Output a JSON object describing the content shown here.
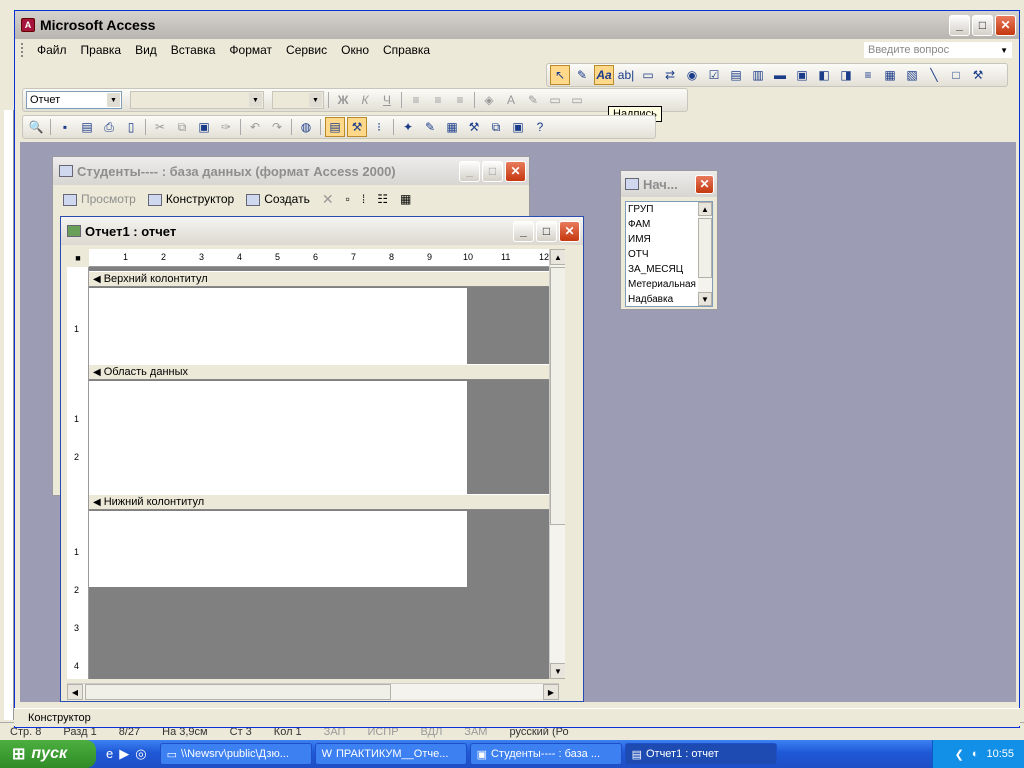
{
  "background": {
    "status_items": [
      "Стр. 8",
      "Разд 1",
      "8/27",
      "На 3,9см",
      "Ст 3",
      "Кол 1",
      "ЗАП",
      "ИСПР",
      "ВДЛ",
      "ЗАМ",
      "русский (Ро"
    ]
  },
  "app": {
    "title": "Microsoft Access",
    "icon_letter": "A",
    "minimize": "_",
    "maximize": "□",
    "close": "✕"
  },
  "menu": {
    "items": [
      "Файл",
      "Правка",
      "Вид",
      "Вставка",
      "Формат",
      "Сервис",
      "Окно",
      "Справка"
    ],
    "ask_placeholder": "Введите вопрос"
  },
  "formatting": {
    "object_combo": "Отчет",
    "font_combo": "",
    "size_combo": "",
    "bold": "Ж",
    "italic": "К",
    "underline": "Ч"
  },
  "tooltip": "Надпись",
  "db_window": {
    "title": "Студенты---- : база данных (формат Access 2000)",
    "preview": "Просмотр",
    "design": "Конструктор",
    "create": "Создать"
  },
  "report_window": {
    "title": "Отчет1 : отчет",
    "ruler_ticks": [
      "1",
      "2",
      "3",
      "4",
      "5",
      "6",
      "7",
      "8",
      "9",
      "10",
      "11",
      "12"
    ],
    "bands": {
      "page_header": "Верхний колонтитул",
      "detail": "Область данных",
      "page_footer": "Нижний колонтитул"
    }
  },
  "field_list": {
    "title": "Нач...",
    "fields": [
      "ГРУП",
      "ФАМ",
      "ИМЯ",
      "ОТЧ",
      "ЗА_МЕСЯЦ",
      "Метериальная",
      "Надбавка"
    ]
  },
  "status_bar": "Конструктор",
  "taskbar": {
    "start": "пуск",
    "tasks": [
      {
        "label": "\\\\Newsrv\\public\\Дзю...",
        "active": false
      },
      {
        "label": "ПРАКТИКУМ__Отче...",
        "active": false
      },
      {
        "label": "Студенты---- : база ...",
        "active": false
      },
      {
        "label": "Отчет1 : отчет",
        "active": true
      }
    ],
    "clock": "10:55"
  }
}
